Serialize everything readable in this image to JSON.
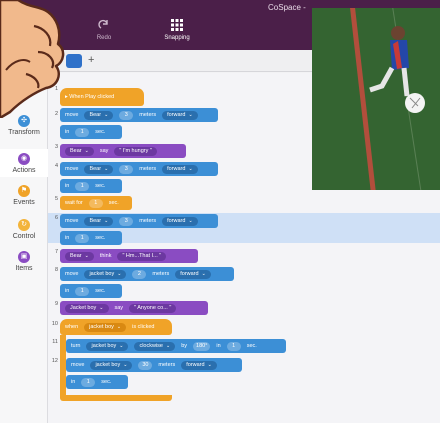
{
  "app": {
    "title": "CoSpace -",
    "toolbar": [
      {
        "label": "Redo",
        "icon": "redo-icon"
      },
      {
        "label": "Snapping",
        "icon": "grid-icon"
      }
    ]
  },
  "tabs": {
    "add_label": "+"
  },
  "categories": [
    {
      "label": "Transform",
      "color": "#3c8fd6",
      "icon": "transform-icon"
    },
    {
      "label": "Actions",
      "color": "#8a4cc2",
      "icon": "actions-icon"
    },
    {
      "label": "Events",
      "color": "#f0a328",
      "icon": "events-icon"
    },
    {
      "label": "Control",
      "color": "#f3b43a",
      "icon": "control-icon"
    },
    {
      "label": "Items",
      "color": "#8a4cc2",
      "icon": "items-icon"
    }
  ],
  "line_numbers": [
    "1",
    "2",
    "3",
    "4",
    "5",
    "6",
    "7",
    "8",
    "9",
    "10",
    "11",
    "12"
  ],
  "code": {
    "l1": {
      "label": "▸ When Play clicked"
    },
    "l2": {
      "verb": "move",
      "target": "Bear",
      "amount": "3",
      "unit": "meters",
      "dir": "forward",
      "in": "in",
      "time": "1",
      "sec": "sec."
    },
    "l3": {
      "target": "Bear",
      "verb": "say",
      "text": "\" I'm hungry \""
    },
    "l4": {
      "verb": "move",
      "target": "Bear",
      "amount": "3",
      "unit": "meters",
      "dir": "forward",
      "in": "in",
      "time": "1",
      "sec": "sec."
    },
    "l5": {
      "verb": "wait for",
      "time": "1",
      "sec": "sec."
    },
    "l6": {
      "verb": "move",
      "target": "Bear",
      "amount": "3",
      "unit": "meters",
      "dir": "forward",
      "in": "in",
      "time": "1",
      "sec": "sec."
    },
    "l7": {
      "target": "Bear",
      "verb": "think",
      "text": "\" Hm...That I... \""
    },
    "l8": {
      "verb": "move",
      "target": "jacket boy",
      "amount": "2",
      "unit": "meters",
      "dir": "forward",
      "in": "in",
      "time": "1",
      "sec": "sec."
    },
    "l9": {
      "target": "Jacket boy",
      "verb": "say",
      "text": "\" Anyone co... \""
    },
    "l10": {
      "verb": "when",
      "target": "jacket boy",
      "event": "is clicked"
    },
    "l11": {
      "verb": "turn",
      "target": "jacket boy",
      "dir": "clockwise",
      "by": "by",
      "amount": "180°",
      "in": "in",
      "time": "1",
      "sec": "sec."
    },
    "l12": {
      "verb": "move",
      "target": "jacket boy",
      "amount": "30",
      "unit": "meters",
      "dir": "forward",
      "in": "in",
      "time": "1",
      "sec": "sec."
    }
  },
  "colors": {
    "motion": "#3c8fd6",
    "looks": "#8a4cc2",
    "events": "#f0a328",
    "header": "#4b1f49"
  }
}
